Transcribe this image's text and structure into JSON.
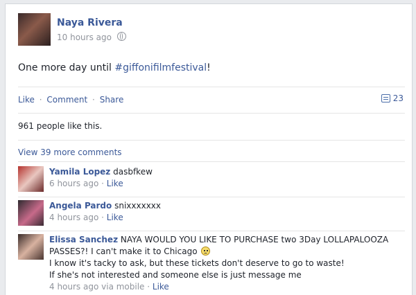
{
  "post": {
    "author": "Naya Rivera",
    "time": "10 hours ago",
    "text": "One more day until ",
    "hashtag": "#giffonifilmfestival",
    "text_end": "!"
  },
  "actions": {
    "like": "Like",
    "comment": "Comment",
    "share": "Share",
    "sep": "·",
    "count": "23"
  },
  "likes_summary": "961 people like this.",
  "view_more": "View 39 more comments",
  "comments": [
    {
      "name": "Yamila Lopez",
      "text": " dasbfkew",
      "time": "6 hours ago",
      "like": "Like"
    },
    {
      "name": "Angela Pardo",
      "text": " snixxxxxxx",
      "time": "4 hours ago",
      "like": "Like"
    },
    {
      "name": "Elissa Sanchez",
      "text": " NAYA WOULD YOU LIKE TO PURCHASE two 3Day LOLLAPALOOZA PASSES?! I can't make it to Chicago ",
      "line2": "I know it's tacky to ask, but these tickets don't deserve to go to waste!",
      "line3": "If she's not interested and someone else is just message me",
      "time": "4 hours ago via mobile",
      "like": "Like"
    }
  ],
  "icons": {
    "privacy": "globe-icon",
    "comments": "comment-icon",
    "emoticon": "frown-face-icon"
  },
  "colors": {
    "link": "#3b5998",
    "meta": "#90949c",
    "text": "#1d2129"
  }
}
